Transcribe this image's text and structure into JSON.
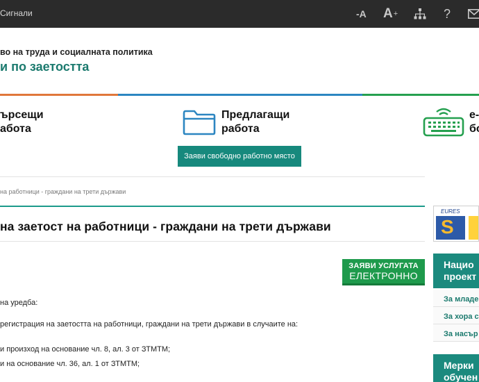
{
  "topbar": {
    "signals": "Сигнали",
    "font_decrease": "-A",
    "font_increase": "A",
    "font_increase_plus": "+",
    "help": "?"
  },
  "header": {
    "ministry": "во на труда и социалната политика",
    "agency": "и по заетостта"
  },
  "categories": [
    {
      "line1": "ърсещи",
      "line2": "абота",
      "icon": "person-icon"
    },
    {
      "line1": "Предлагащи",
      "line2": "работа",
      "icon": "folder-icon"
    },
    {
      "line1": "е-",
      "line2": "бо",
      "icon": "keyboard-icon"
    }
  ],
  "vacancy_button": "Заяви свободно работно място",
  "breadcrumb": "на работници - граждани на трети държави",
  "page_title": "на заетост на работници - граждани на трети държави",
  "eservice_button": {
    "line1": "ЗАЯВИ УСЛУГАТА",
    "line2": "ЕЛЕКТРОННО"
  },
  "content": [
    "на уредба:",
    "регистрация на заетостта на работници, граждани на трети държави в случаите на:",
    "и произход на основание чл. 8, ал. 3 от ЗТМТМ;",
    "и на основание чл. 36, ал. 1 от ЗТМТМ;"
  ],
  "sidebar": {
    "eures_label": "EURES",
    "block1_title_l1": "Нацио",
    "block1_title_l2": "проект",
    "links": [
      "За младе",
      "За хора с",
      "За насър"
    ],
    "block2_title_l1": "Мерки",
    "block2_title_l2": "обучен"
  },
  "colors": {
    "accent_teal": "#1b8a7e",
    "orange": "#e0773b",
    "blue": "#2c86c1",
    "green": "#25a04f",
    "eservice_green": "#1e9a4c"
  }
}
